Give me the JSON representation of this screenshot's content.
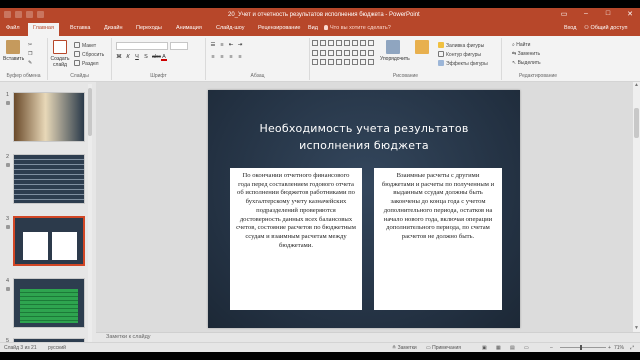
{
  "window": {
    "title": "20_Учет и отчетность результатов исполнения бюджета - PowerPoint",
    "sign_in": "Вход",
    "share": "Общий доступ"
  },
  "tabs": [
    {
      "label": "Файл"
    },
    {
      "label": "Главная"
    },
    {
      "label": "Вставка"
    },
    {
      "label": "Дизайн"
    },
    {
      "label": "Переходы"
    },
    {
      "label": "Анимация"
    },
    {
      "label": "Слайд-шоу"
    },
    {
      "label": "Рецензирование"
    },
    {
      "label": "Вид"
    }
  ],
  "tell_me": "Что вы хотите сделать?",
  "ribbon": {
    "clipboard": {
      "paste": "Вставить",
      "label": "Буфер обмена"
    },
    "slides": {
      "new_slide": "Создать слайд",
      "layout": "Макет",
      "reset": "Сбросить",
      "section": "Раздел",
      "label": "Слайды"
    },
    "font": {
      "label": "Шрифт"
    },
    "paragraph": {
      "label": "Абзац"
    },
    "drawing": {
      "arrange": "Упорядочить",
      "shape_fill": "Заливка фигуры",
      "shape_outline": "Контур фигуры",
      "shape_effects": "Эффекты фигуры",
      "label": "Рисование"
    },
    "editing": {
      "find": "Найти",
      "replace": "Заменить",
      "select": "Выделить",
      "label": "Редактирование"
    }
  },
  "thumbnails": [
    {
      "num": "1",
      "theme": "photo"
    },
    {
      "num": "2",
      "theme": "dark-text"
    },
    {
      "num": "3",
      "theme": "current",
      "selected": true
    },
    {
      "num": "4",
      "theme": "green-text"
    },
    {
      "num": "5",
      "theme": "dark"
    }
  ],
  "slide": {
    "title_line1": "Необходимость учета результатов",
    "title_line2": "исполнения бюджета",
    "left_text": "По окончании отчетного финансового года перед составлением годового отчета об исполнении бюджетов работниками по бухгалтерскому учету казначейских подразделений проверяются достоверность данных всех балансовых счетов, состояние расчетов по бюджетным ссудам и взаимным расчетам между бюджетами.",
    "right_text": "Взаимные расчеты с другими бюджетами и расчеты по полученным и выданным ссудам должны быть закончены до конца года с учетом дополнительного периода, остатков на начало нового года, включая операции дополнительного периода, по счетам расчетов не должно быть."
  },
  "notes_placeholder": "Заметки к слайду",
  "status": {
    "slide_counter": "Слайд 3 из 21",
    "language": "русский",
    "notes_btn": "Заметки",
    "comments_btn": "Примечания",
    "zoom": "71%"
  },
  "colors": {
    "accent": "#b7472a",
    "slide_bg": "#263547",
    "selected_thumb": "#d24726"
  }
}
